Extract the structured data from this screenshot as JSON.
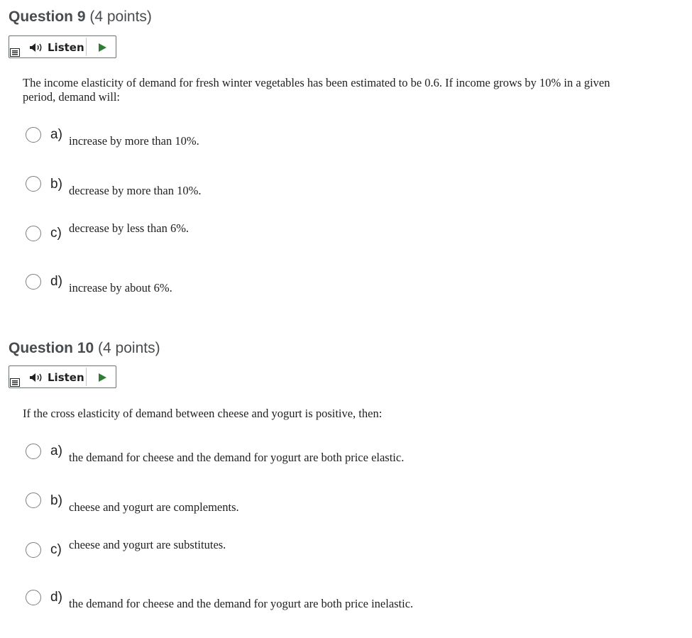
{
  "questions": [
    {
      "title": "Question 9",
      "points": "(4 points)",
      "listen_label": "Listen",
      "stem": "The income elasticity of demand for fresh winter vegetables has been estimated to be 0.6. If income grows by 10% in a given period, demand will:",
      "choices": [
        {
          "letter": "a)",
          "text": "increase by more than 10%."
        },
        {
          "letter": "b)",
          "text": "decrease by more than 10%."
        },
        {
          "letter": "c)",
          "text": "decrease by less than 6%."
        },
        {
          "letter": "d)",
          "text": "increase by about 6%."
        }
      ]
    },
    {
      "title": "Question 10",
      "points": "(4 points)",
      "listen_label": "Listen",
      "stem": "If the cross elasticity of demand between cheese and yogurt is positive, then:",
      "choices": [
        {
          "letter": "a)",
          "text": "the demand for cheese and the demand for yogurt are both price elastic."
        },
        {
          "letter": "b)",
          "text": "cheese and yogurt are complements."
        },
        {
          "letter": "c)",
          "text": "cheese and yogurt are substitutes."
        },
        {
          "letter": "d)",
          "text": "the demand for cheese and the demand for yogurt are both price inelastic."
        }
      ]
    }
  ],
  "icons": {
    "menu": "menu-lines-icon",
    "speaker": "speaker-icon",
    "play": "play-icon"
  },
  "colors": {
    "play": "#2e7d32",
    "text": "#202122",
    "title": "#494c4e"
  }
}
